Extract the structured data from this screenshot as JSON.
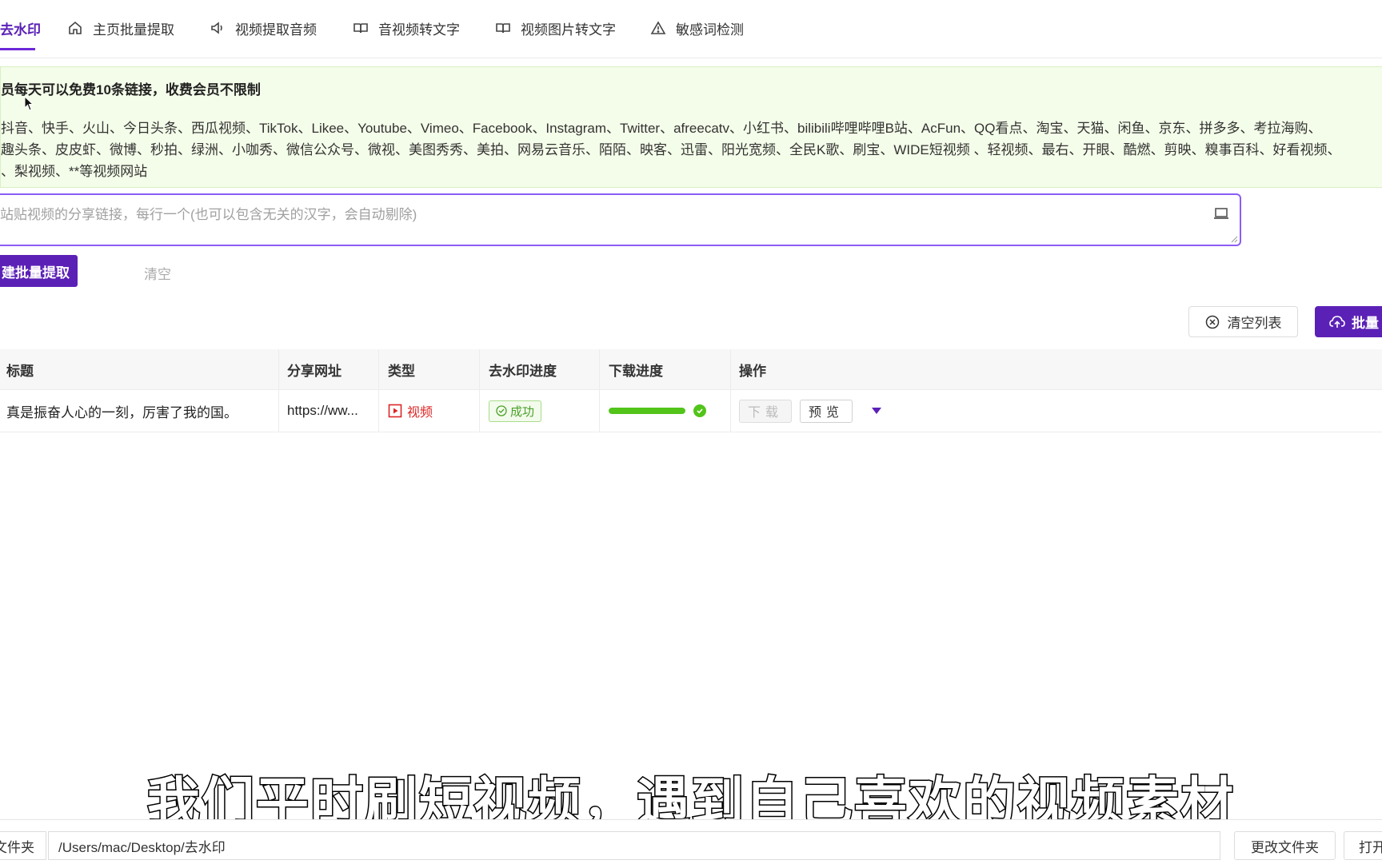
{
  "tabs": [
    {
      "label": "去水印",
      "icon": "none",
      "active": true
    },
    {
      "label": "主页批量提取",
      "icon": "home-icon"
    },
    {
      "label": "视频提取音频",
      "icon": "speaker-icon"
    },
    {
      "label": "音视频转文字",
      "icon": "book-icon"
    },
    {
      "label": "视频图片转文字",
      "icon": "book-icon"
    },
    {
      "label": "敏感词检测",
      "icon": "warning-icon"
    }
  ],
  "notice": {
    "title": "员每天可以免费10条链接，收费会员不限制",
    "line1": "抖音、快手、火山、今日头条、西瓜视频、TikTok、Likee、Youtube、Vimeo、Facebook、Instagram、Twitter、afreecatv、小红书、bilibili哔哩哔哩B站、AcFun、QQ看点、淘宝、天猫、闲鱼、京东、拼多多、考拉海购、",
    "line2": "趣头条、皮皮虾、微博、秒拍、绿洲、小咖秀、微信公众号、微视、美图秀秀、美拍、网易云音乐、陌陌、映客、迅雷、阳光宽频、全民K歌、刷宝、WIDE短视频 、轻视频、最右、开眼、酷燃、剪映、糗事百科、好看视频、",
    "line3": "、梨视频、**等视频网站"
  },
  "input": {
    "placeholder": "站贴视频的分享链接，每行一个(也可以包含无关的汉字，会自动剔除)"
  },
  "actions": {
    "extract_label": "建批量提取",
    "clear_label": "清空",
    "clear_list_label": "清空列表",
    "batch_label": "批量"
  },
  "table": {
    "headers": {
      "title": "标题",
      "url": "分享网址",
      "type": "类型",
      "watermark": "去水印进度",
      "download": "下载进度",
      "ops": "操作"
    },
    "rows": [
      {
        "title": "真是振奋人心的一刻，厉害了我的国。",
        "url": "https://ww...",
        "type": "视频",
        "status": "成功",
        "download_progress": 1.0,
        "download_btn": "下载",
        "preview_btn": "预览"
      }
    ]
  },
  "subtitle": "我们平时刷短视频，遇到自己喜欢的视频素材",
  "footer": {
    "label": "文件夹",
    "path": "/Users/mac/Desktop/去水印",
    "change_btn": "更改文件夹",
    "open_btn": "打开"
  },
  "colors": {
    "accent": "#5b21b6",
    "success": "#52c41a",
    "danger": "#dc2626",
    "notice_bg": "#f4fde9"
  }
}
